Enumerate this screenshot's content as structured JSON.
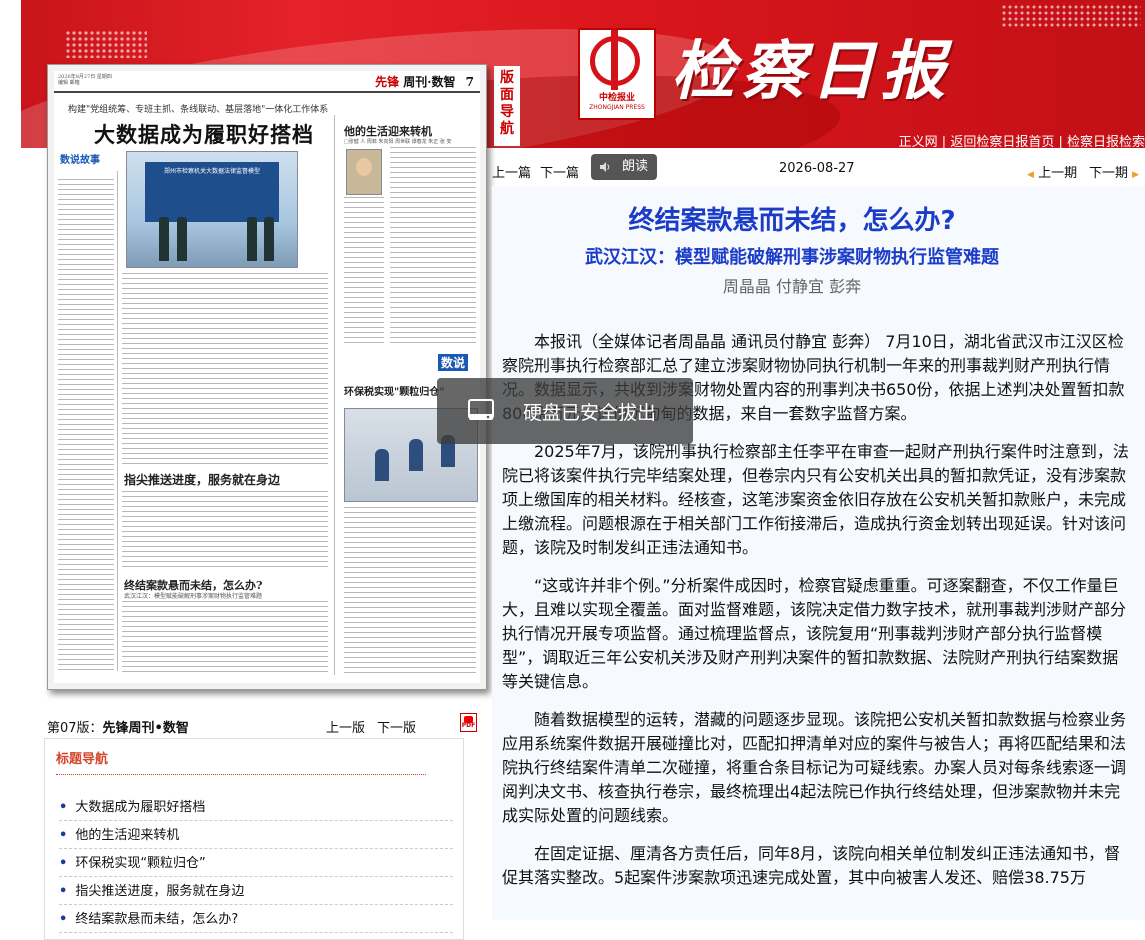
{
  "site": {
    "brand": "检察日报",
    "logo_cn": "中检报业",
    "logo_en": "ZHONGJIAN PRESS",
    "top_links": [
      "正义网",
      "返回检察日报首页",
      "检察日报检索"
    ],
    "nav_tag": "版面导航"
  },
  "paper_thumb": {
    "header_section": "先锋",
    "header_section_rest": "周刊·数智",
    "page_no": "7",
    "meta_line1": "2026年8月27日 星期四",
    "meta_line2": "编辑 邮箱",
    "subtitle": "构建\"党组统筹、专班主抓、条线联动、基层落地\"一体化工作体系",
    "title": "大数据成为履职好搭档",
    "tag": "数说故事",
    "photo_caption": "郑州市检察机关大数据法律监督模型",
    "right_title": "他的生活迎来转机",
    "right_sub": "□张健 人 周菲 朱向阳 周世联 谭春龙 朱正 张 安",
    "shuo": "数说",
    "t3": "环保税实现\"颗粒归仓\"",
    "t4": "指尖推送进度，服务就在身边",
    "t5": "终结案款悬而未结，怎么办?",
    "t5s": "武汉江汉：模型赋能破解刑事涉案财物执行监管难题"
  },
  "pager": {
    "label_prefix": "第07版：",
    "label_name": "先锋周刊•数智",
    "prev": "上一版",
    "next": "下一版",
    "pdf": "PDF"
  },
  "title_nav": {
    "heading": "标题导航",
    "items": [
      "大数据成为履职好搭档",
      "他的生活迎来转机",
      "环保税实现“颗粒归仓”",
      "指尖推送进度，服务就在身边",
      "终结案款悬而未结，怎么办?"
    ]
  },
  "toolbar": {
    "prev_article": "上一篇",
    "next_article": "下一篇",
    "listen": "朗读",
    "date": "2026-08-27",
    "prev_issue": "上一期",
    "next_issue": "下一期"
  },
  "article": {
    "title": "终结案款悬而未结，怎么办?",
    "subtitle": "武汉江汉：模型赋能破解刑事涉案财物执行监管难题",
    "authors": "周晶晶 付静宜 彭奔",
    "paragraphs": [
      "本报讯（全媒体记者周晶晶 通讯员付静宜 彭奔） 7月10日，湖北省武汉市江汉区检察院刑事执行检察部汇总了建立涉案财物协同执行机制一年来的刑事裁判财产刑执行情况。数据显示，共收到涉案财物处置内容的刑事判决书650份，依据上述判决处置暂扣款800余万元。这份沉甸甸的数据，来自一套数字监督方案。",
      "2025年7月，该院刑事执行检察部主任李平在审查一起财产刑执行案件时注意到，法院已将该案件执行完毕结案处理，但卷宗内只有公安机关出具的暂扣款凭证，没有涉案款项上缴国库的相关材料。经核查，这笔涉案资金依旧存放在公安机关暂扣款账户，未完成上缴流程。问题根源在于相关部门工作衔接滞后，造成执行资金划转出现延误。针对该问题，该院及时制发纠正违法通知书。",
      "“这或许并非个例。”分析案件成因时，检察官疑虑重重。可逐案翻查，不仅工作量巨大，且难以实现全覆盖。面对监督难题，该院决定借力数字技术，就刑事裁判涉财产部分执行情况开展专项监督。通过梳理监督点，该院复用“刑事裁判涉财产部分执行监督模型”，调取近三年公安机关涉及财产刑判决案件的暂扣款数据、法院财产刑执行结案数据等关键信息。",
      "随着数据模型的运转，潜藏的问题逐步显现。该院把公安机关暂扣款数据与检察业务应用系统案件数据开展碰撞比对，匹配扣押清单对应的案件与被告人；再将匹配结果和法院执行终结案件清单二次碰撞，将重合条目标记为可疑线索。办案人员对每条线索逐一调阅判决文书、核查执行卷宗，最终梳理出4起法院已作执行终结处理，但涉案款物并未完成实际处置的问题线索。",
      "在固定证据、厘清各方责任后，同年8月，该院向相关单位制发纠正违法通知书，督促其落实整改。5起案件涉案款项迅速完成处置，其中向被害人发还、赔偿38.75万"
    ]
  },
  "toast": {
    "message": "硬盘已安全拔出"
  },
  "colors": {
    "banner_red": "#d8161c",
    "title_blue": "#1a3cc8",
    "nav_heading": "#d4452a"
  }
}
